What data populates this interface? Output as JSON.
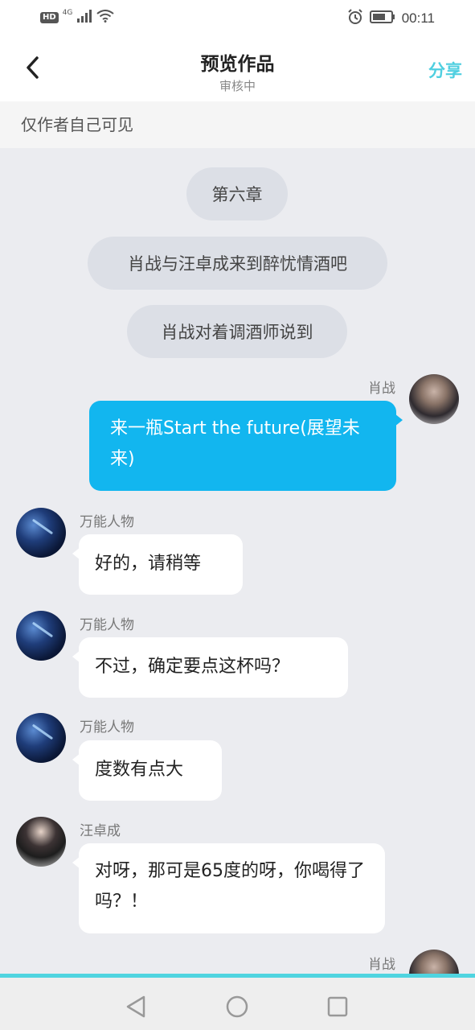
{
  "status_bar": {
    "hd": "HD",
    "network": "4G",
    "time": "00:11",
    "icons": [
      "signal-icon",
      "wifi-icon",
      "alarm-icon",
      "battery-icon"
    ]
  },
  "header": {
    "back_icon": "chevron-left-icon",
    "title": "预览作品",
    "subtitle": "审核中",
    "share_label": "分享",
    "share_color": "#4fcfe0"
  },
  "notice": {
    "text": "仅作者自己可见"
  },
  "narration": [
    "第六章",
    "肖战与汪卓成来到醉忧情酒吧",
    "肖战对着调酒师说到"
  ],
  "messages": [
    {
      "speaker": "肖战",
      "side": "right",
      "text": "来一瓶Start the future(展望未来)"
    },
    {
      "speaker": "万能人物",
      "side": "left",
      "text": "好的，请稍等"
    },
    {
      "speaker": "万能人物",
      "side": "left",
      "text": "不过，确定要点这杯吗？"
    },
    {
      "speaker": "万能人物",
      "side": "left",
      "text": "度数有点大"
    },
    {
      "speaker": "汪卓成",
      "side": "left",
      "text": "对呀，那可是65度的呀，你喝得了吗？！"
    },
    {
      "speaker": "肖战",
      "side": "right",
      "text": ""
    }
  ],
  "colors": {
    "right_bubble": "#12b6ef",
    "left_bubble": "#ffffff",
    "chat_background": "#ebecf0",
    "nav_accent": "#4fd4e0"
  },
  "nav_bar": {
    "icons": [
      "back-triangle-icon",
      "home-circle-icon",
      "recents-square-icon"
    ]
  }
}
